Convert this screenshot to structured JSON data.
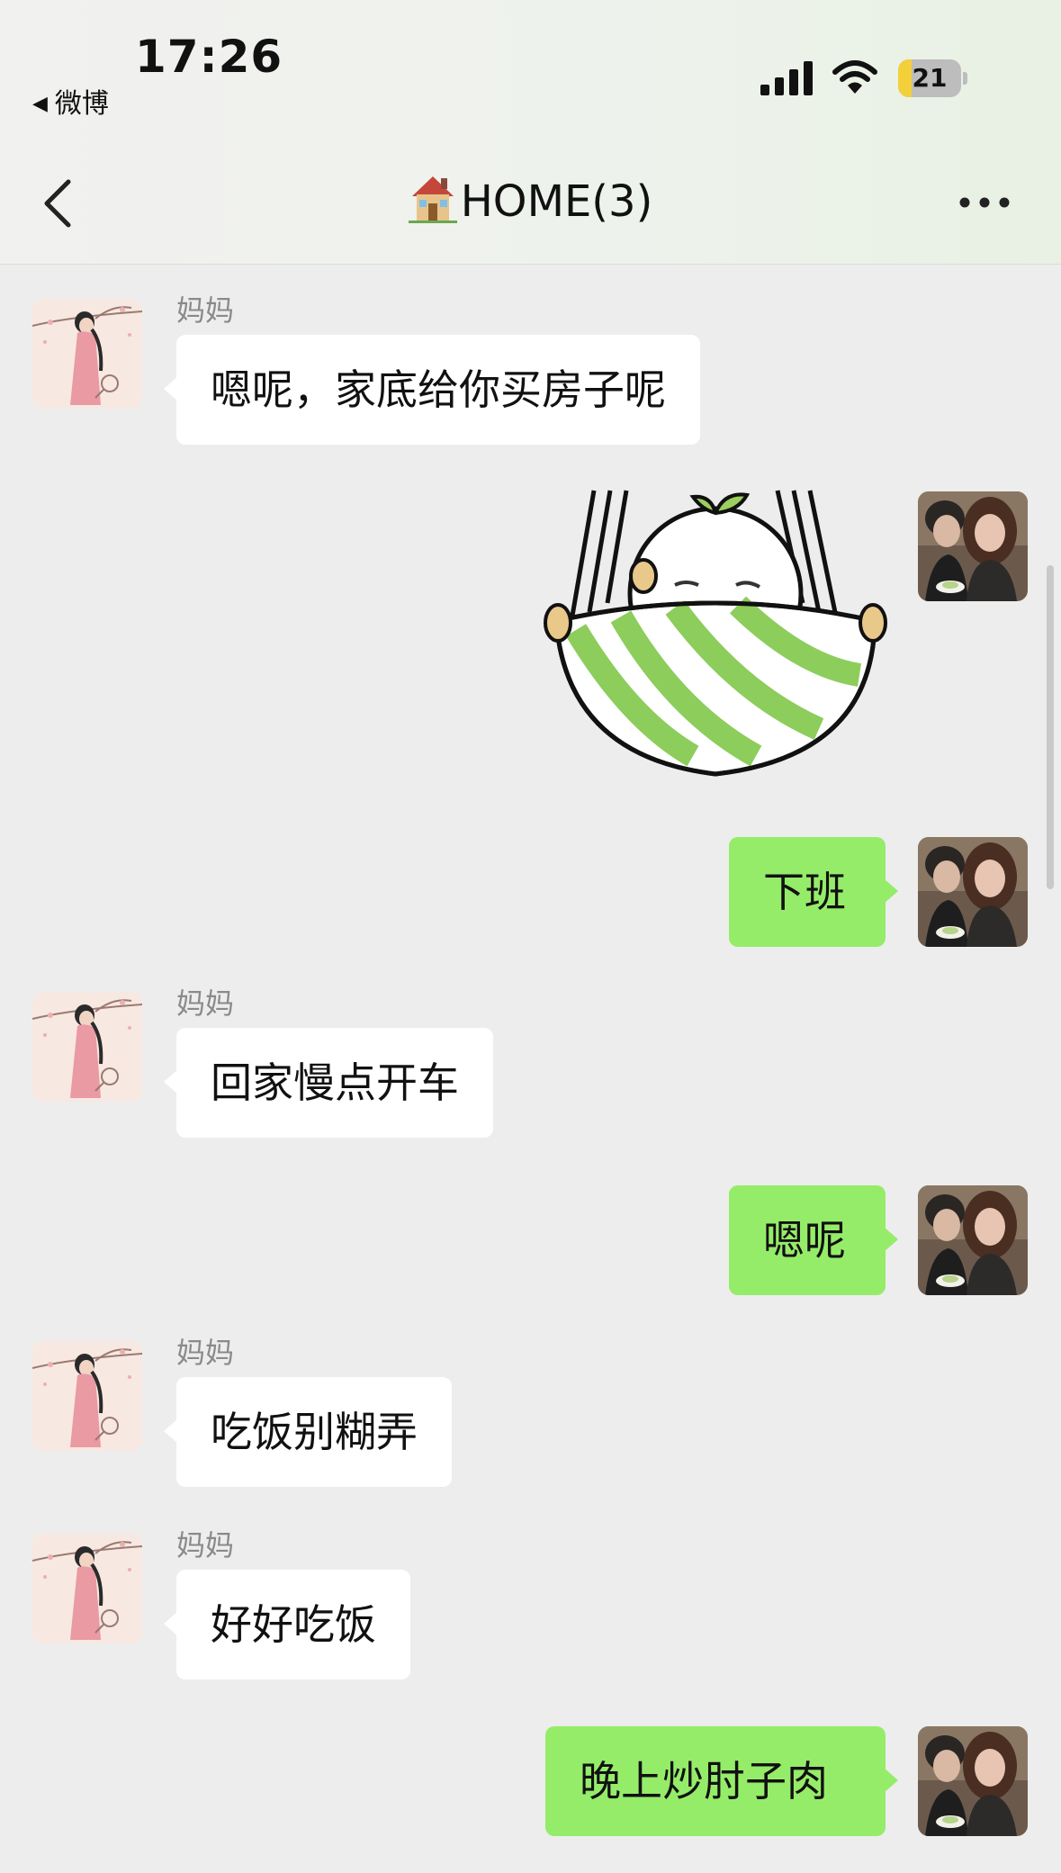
{
  "status_bar": {
    "time": "17:26",
    "back_app": "微博",
    "battery": "21",
    "battery_level": 0.21
  },
  "nav": {
    "title": "HOME(3)",
    "title_icon": "house-emoji",
    "back_icon": "chevron-left-icon",
    "more_icon": "more-dots-icon"
  },
  "messages": [
    {
      "side": "in",
      "sender": "妈妈",
      "text": "嗯呢，家底给你买房子呢"
    },
    {
      "side": "out",
      "type": "sticker",
      "sticker": "sprout-ball-in-hammock"
    },
    {
      "side": "out",
      "text": "下班"
    },
    {
      "side": "in",
      "sender": "妈妈",
      "text": "回家慢点开车"
    },
    {
      "side": "out",
      "text": "嗯呢"
    },
    {
      "side": "in",
      "sender": "妈妈",
      "text": "吃饭别糊弄"
    },
    {
      "side": "in",
      "sender": "妈妈",
      "text": "好好吃饭"
    },
    {
      "side": "out",
      "text": "晚上炒肘子肉"
    }
  ],
  "colors": {
    "chat_bg": "#ededed",
    "incoming_bubble": "#ffffff",
    "outgoing_bubble": "#95ec69",
    "sender_name": "#8a8a8a"
  }
}
